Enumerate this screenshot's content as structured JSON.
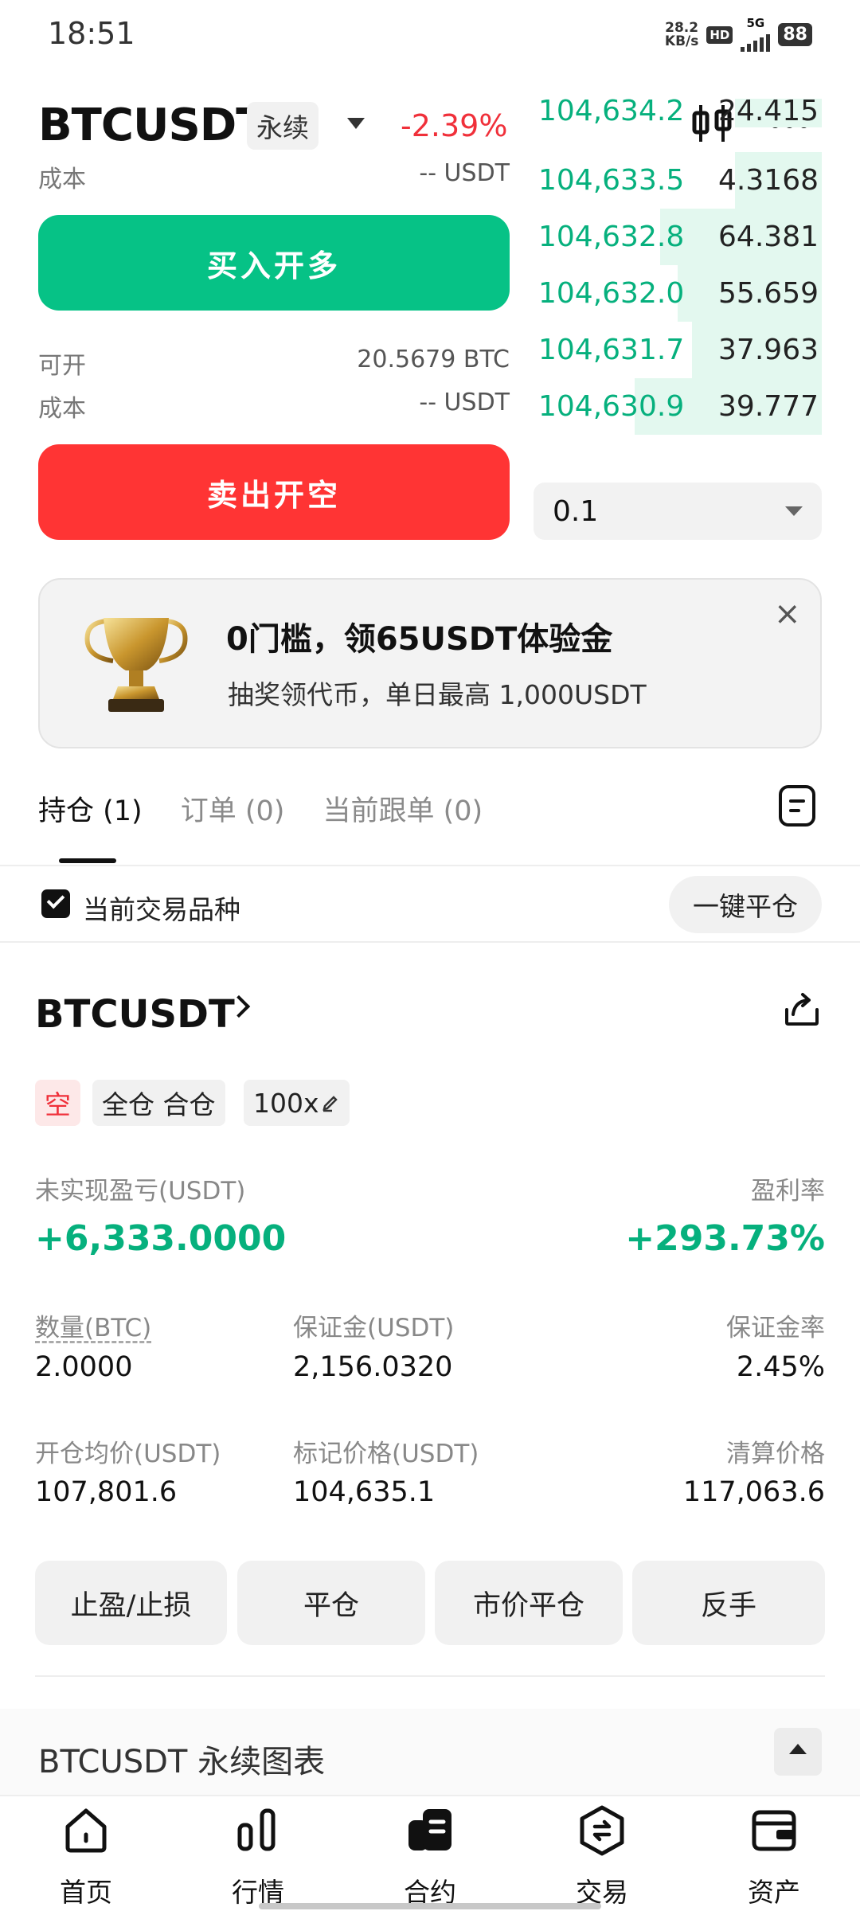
{
  "status_bar": {
    "time": "18:51",
    "net_speed_value": "28.2",
    "net_speed_unit": "KB/s",
    "hd": "HD",
    "network": "5G",
    "battery": "88"
  },
  "header": {
    "symbol": "BTCUSDT",
    "contract_type": "永续",
    "change_pct": "-2.39%"
  },
  "form": {
    "cost_label_top": "成本",
    "cost_value_top": "-- USDT",
    "buy_button": "买入开多",
    "available_label": "可开",
    "available_value": "20.5679 BTC",
    "cost_label": "成本",
    "cost_value": "-- USDT",
    "sell_button": "卖出开空"
  },
  "orderbook": {
    "rows": [
      {
        "price": "104,634.2",
        "qty": "24.415",
        "depth": 0.3
      },
      {
        "price": "104,633.5",
        "qty": "4.3168",
        "depth": 0.3
      },
      {
        "price": "104,632.8",
        "qty": "64.381",
        "depth": 0.56
      },
      {
        "price": "104,632.0",
        "qty": "55.659",
        "depth": 0.5
      },
      {
        "price": "104,631.7",
        "qty": "37.963",
        "depth": 0.45
      },
      {
        "price": "104,630.9",
        "qty": "39.777",
        "depth": 0.65
      }
    ],
    "depth_precision": "0.1"
  },
  "promo": {
    "title": "0门槛，领65USDT体验金",
    "subtitle": "抽奖领代币，单日最高 1,000USDT",
    "close": "×"
  },
  "tabs": [
    "持仓 (1)",
    "订单 (0)",
    "当前跟单 (0)"
  ],
  "filter": {
    "label": "当前交易品种",
    "close_all": "一键平仓"
  },
  "position": {
    "symbol": "BTCUSDT",
    "tags": {
      "side": "空",
      "margin_mode": "全仓 合仓",
      "leverage": "100x"
    },
    "pnl_label": "未实现盈亏(USDT)",
    "pnl_value": "+6,333.0000",
    "roe_label": "盈利率",
    "roe_value": "+293.73%",
    "qty_label": "数量(BTC)",
    "qty_value": "2.0000",
    "margin_label": "保证金(USDT)",
    "margin_value": "2,156.0320",
    "margin_ratio_label": "保证金率",
    "margin_ratio_value": "2.45%",
    "entry_label": "开仓均价(USDT)",
    "entry_value": "107,801.6",
    "mark_label": "标记价格(USDT)",
    "mark_value": "104,635.1",
    "liq_label": "清算价格",
    "liq_value": "117,063.6",
    "actions": [
      "止盈/止损",
      "平仓",
      "市价平仓",
      "反手"
    ]
  },
  "chart_section": {
    "title": "BTCUSDT 永续图表"
  },
  "bottom_nav": [
    "首页",
    "行情",
    "合约",
    "交易",
    "资产"
  ],
  "colors": {
    "green": "#06c286",
    "red": "#ff3434",
    "green_text": "#06b07d"
  }
}
